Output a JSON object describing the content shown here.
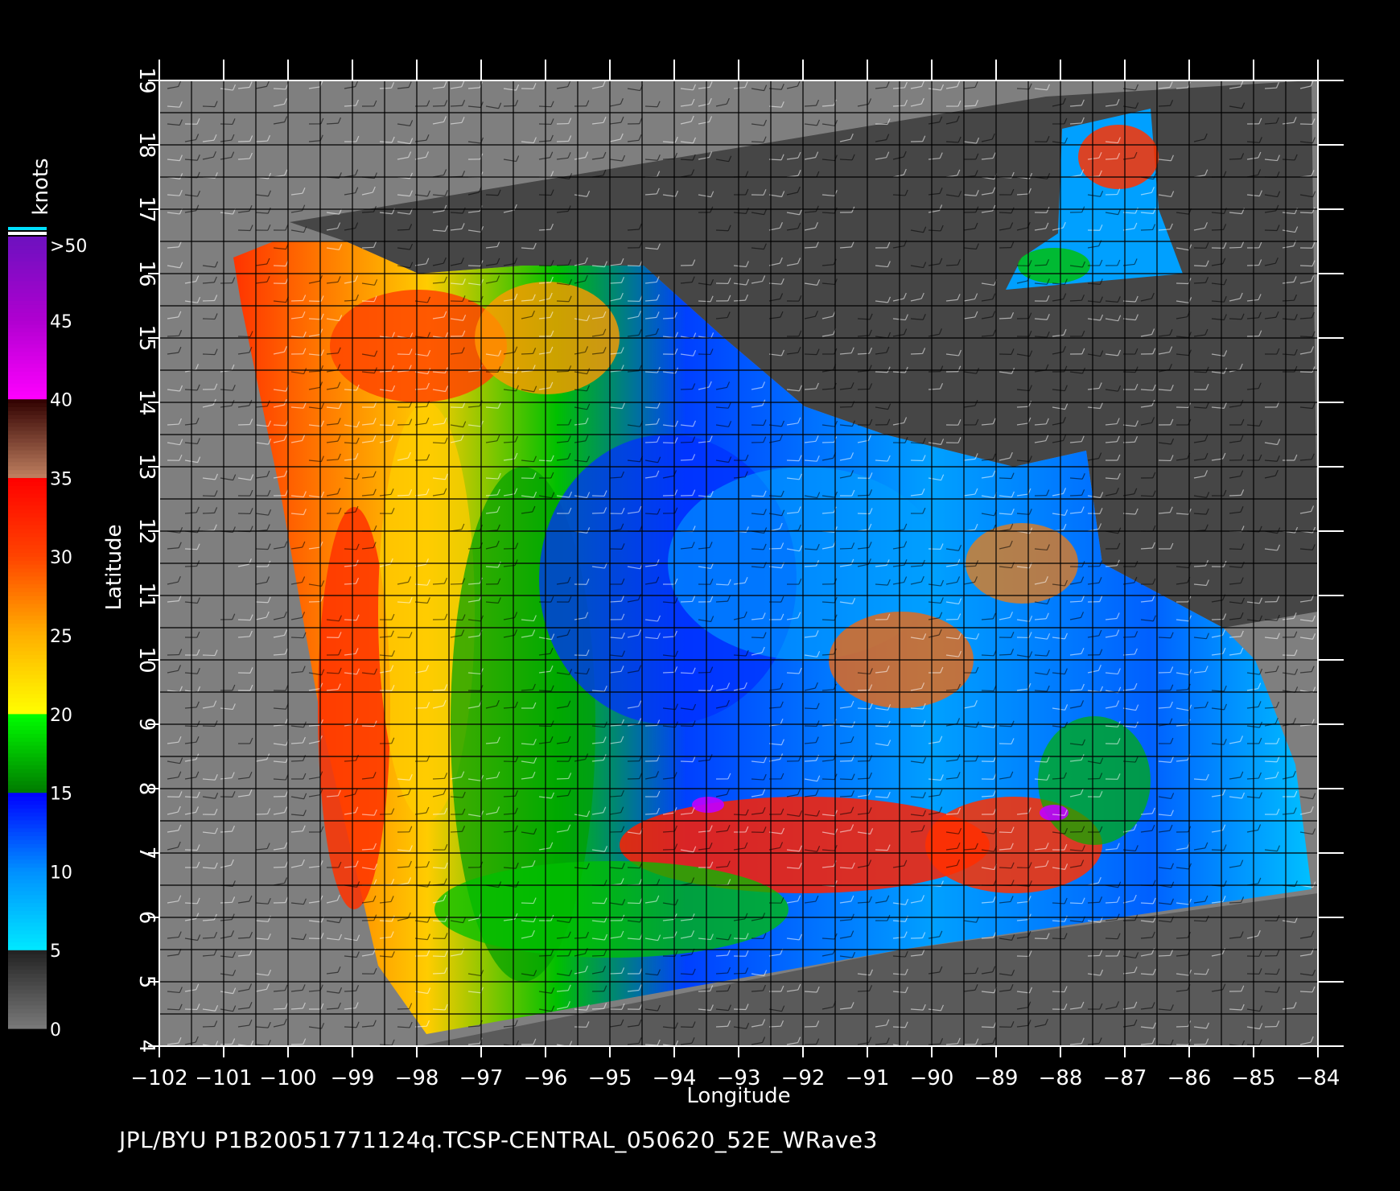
{
  "map": {
    "x_axis_label": "Longitude",
    "y_axis_label": "Latitude",
    "lon_range": [
      -102,
      -84
    ],
    "lat_range": [
      4,
      19
    ],
    "lon_ticks": [
      "−102",
      "−101",
      "−100",
      "−99",
      "−98",
      "−97",
      "−96",
      "−95",
      "−94",
      "−93",
      "−92",
      "−91",
      "−90",
      "−89",
      "−88",
      "−87",
      "−86",
      "−85",
      "−84"
    ],
    "lat_ticks": [
      "4",
      "5",
      "6",
      "7",
      "8",
      "9",
      "10",
      "11",
      "12",
      "13",
      "14",
      "15",
      "16",
      "17",
      "18",
      "19"
    ],
    "grid": true,
    "land_color": "#464646",
    "nodata_color": "#7f7f7f",
    "background_color": "#000000"
  },
  "colorbar": {
    "unit_label": "knots",
    "tick_labels": [
      "0",
      "5",
      "10",
      "15",
      "20",
      "25",
      "30",
      "35",
      "40",
      "45",
      ">50"
    ],
    "stops": [
      {
        "value": 0,
        "color": "#7a7a7a"
      },
      {
        "value": 5,
        "color": "#222222"
      },
      {
        "value": 5.01,
        "color": "#00e8ff"
      },
      {
        "value": 10,
        "color": "#0090ff"
      },
      {
        "value": 15,
        "color": "#0000ff"
      },
      {
        "value": 15.01,
        "color": "#007a00"
      },
      {
        "value": 20,
        "color": "#00ff00"
      },
      {
        "value": 20.01,
        "color": "#ffff00"
      },
      {
        "value": 25,
        "color": "#ffb000"
      },
      {
        "value": 30,
        "color": "#ff4400"
      },
      {
        "value": 35,
        "color": "#ff0000"
      },
      {
        "value": 35.01,
        "color": "#c08060"
      },
      {
        "value": 40,
        "color": "#300000"
      },
      {
        "value": 40.01,
        "color": "#ff00ff"
      },
      {
        "value": 45,
        "color": "#b000d0"
      },
      {
        "value": 50,
        "color": "#7010c0"
      }
    ]
  },
  "footer": {
    "text": "JPL/BYU  P1B20051771124q.TCSP-CENTRAL_050620_52E_WRave3"
  }
}
